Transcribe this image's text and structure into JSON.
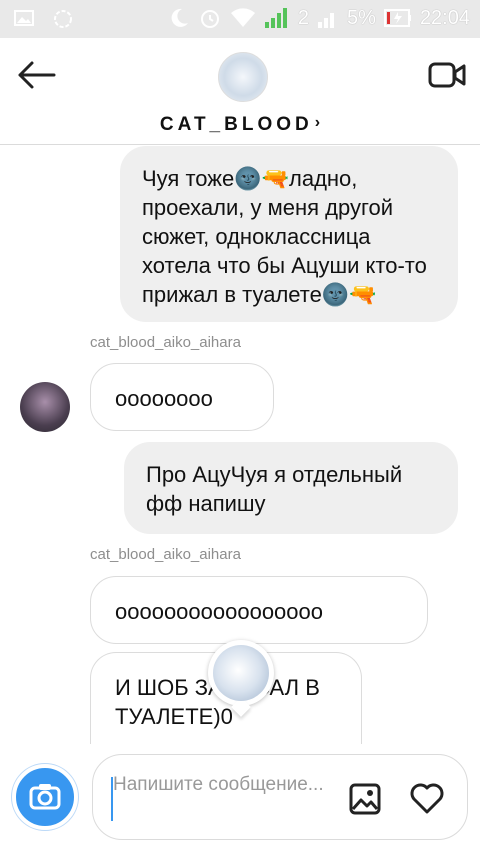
{
  "status_bar": {
    "battery": "5%",
    "time": "22:04",
    "sim": "2"
  },
  "header": {
    "username": "CAT_BLOOD",
    "chevron": "›"
  },
  "messages": [
    {
      "type": "out",
      "text": "Чуя тоже🌚🔫ладно, проехали, у меня другой сюжет, одноклассница хотела что бы Ацуши кто-то прижал в туалете🌚🔫"
    },
    {
      "type": "sender",
      "text": "cat_blood_aiko_aihara"
    },
    {
      "type": "in",
      "text": "оооооооо"
    },
    {
      "type": "out",
      "text": "Про АцуЧуя я отдельный фф напишу"
    },
    {
      "type": "sender",
      "text": "cat_blood_aiko_aihara"
    },
    {
      "type": "in",
      "text": "ооооооооооооооооо"
    },
    {
      "type": "in",
      "text": "И ШОБ ЗАПИСАЛ В ТУАЛЕТЕ)0"
    }
  ],
  "composer": {
    "placeholder": "Напишите сообщение..."
  },
  "icons": {
    "back": "arrow-left-icon",
    "video": "video-camera-icon",
    "camera": "camera-icon",
    "gallery": "image-icon",
    "like": "heart-icon"
  },
  "colors": {
    "accent": "#3897f0",
    "outgoing_bubble": "#efefef",
    "statusbar": "#e9e9e9"
  }
}
